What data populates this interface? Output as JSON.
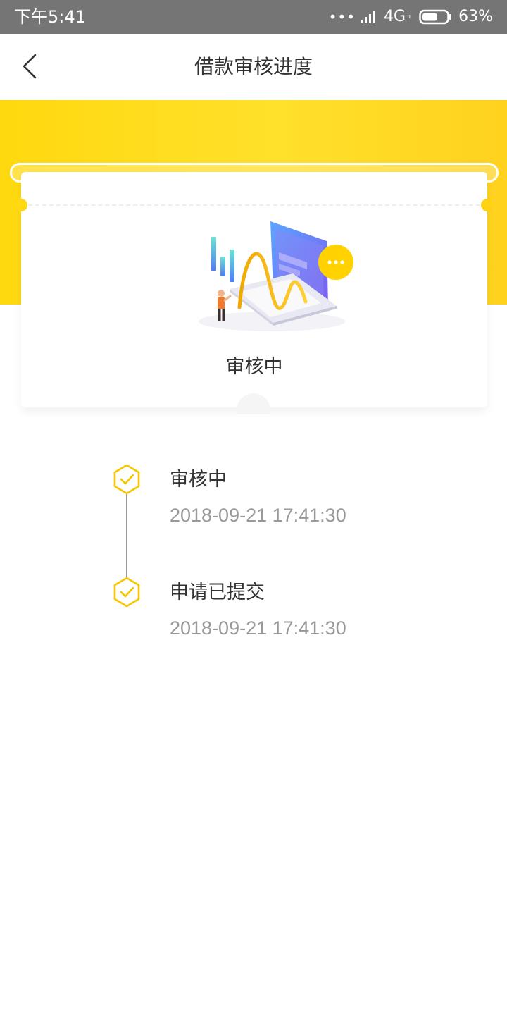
{
  "status_bar": {
    "time": "下午5:41",
    "dots": "•••",
    "network": "4G",
    "network_sub": "ıı",
    "battery_percent": "63%",
    "battery_level": 0.63
  },
  "nav": {
    "back_icon": "chevron-left-icon",
    "title": "借款审核进度"
  },
  "card": {
    "illustration_icon": "laptop-chart-illustration",
    "status": "审核中"
  },
  "timeline": {
    "items": [
      {
        "title": "审核中",
        "time": "2018-09-21 17:41:30",
        "icon": "hexagon-check-icon"
      },
      {
        "title": "申请已提交",
        "time": "2018-09-21 17:41:30",
        "icon": "hexagon-check-icon"
      }
    ]
  },
  "colors": {
    "brand_yellow": "#ffd911",
    "status_bar": "#757575",
    "text_primary": "#333333",
    "text_secondary": "#999999",
    "check_yellow": "#f7c600"
  }
}
